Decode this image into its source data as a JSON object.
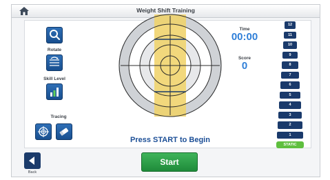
{
  "window": {
    "title": "Weight Shift Training"
  },
  "toolbar": {
    "rotate_label": "Rotate",
    "skill_level_label": "Skill Level",
    "tracing_label": "Tracing"
  },
  "stats": {
    "time_label": "Time",
    "time_value": "00:00",
    "score_label": "Score",
    "score_value": "0"
  },
  "levels": [
    "12",
    "11",
    "10",
    "9",
    "8",
    "7",
    "6",
    "5",
    "4",
    "3",
    "2",
    "1"
  ],
  "static_label": "STATIC",
  "prompt": "Press START to Begin",
  "buttons": {
    "start_label": "Start",
    "back_label": "Back"
  },
  "colors": {
    "accent_blue": "#1b4e96",
    "start_green": "#2aa04a",
    "target_yellow": "#f0d36a",
    "level_pill": "#1a3a6b",
    "static_green": "#5fbf3f"
  },
  "icons": {
    "home": "home-icon",
    "zoom": "magnifier-icon",
    "rotate": "rotate-grid-icon",
    "skill": "bar-chart-icon",
    "tracing_target": "crosshair-icon",
    "tracing_erase": "eraser-icon",
    "back": "back-arrow-icon"
  }
}
